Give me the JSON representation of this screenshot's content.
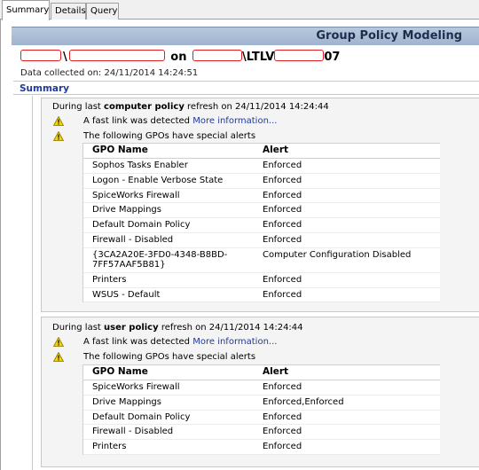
{
  "tabs": [
    {
      "label": "Summary"
    },
    {
      "label": "Details"
    },
    {
      "label": "Query"
    }
  ],
  "report_title": "Group Policy Modeling",
  "header": {
    "separator": "\\",
    "on_word": "on",
    "machine_middle": "\\LTLV",
    "machine_suffix": "07"
  },
  "data_collected": "Data collected on: 24/11/2014 14:24:51",
  "summary_label": "Summary",
  "colors": {
    "accent_link": "#1f3a99",
    "header_bar": "#9fb3cd",
    "redaction": "#e02020",
    "warning": "#f2d400"
  },
  "computer_section": {
    "prefix": "During last",
    "policy_label": "computer policy",
    "suffix": "refresh on 24/11/2014 14:24:44",
    "fast_link_text": "A fast link was detected",
    "more_info_link": "More information...",
    "gpo_alert_text": "The following GPOs have special alerts",
    "icon": "warning-icon",
    "columns": [
      "GPO Name",
      "Alert"
    ],
    "rows": [
      [
        "Sophos Tasks Enabler",
        "Enforced"
      ],
      [
        "Logon - Enable Verbose State",
        "Enforced"
      ],
      [
        "SpiceWorks Firewall",
        "Enforced"
      ],
      [
        "Drive Mappings",
        "Enforced"
      ],
      [
        "Default Domain Policy",
        "Enforced"
      ],
      [
        "Firewall - Disabled",
        "Enforced"
      ],
      [
        "{3CA2A20E-3FD0-4348-B8BD-7FF57AAF5B81}",
        "Computer Configuration Disabled"
      ],
      [
        "Printers",
        "Enforced"
      ],
      [
        "WSUS - Default",
        "Enforced"
      ]
    ]
  },
  "user_section": {
    "prefix": "During last",
    "policy_label": "user policy",
    "suffix": "refresh on 24/11/2014 14:24:44",
    "fast_link_text": "A fast link was detected",
    "more_info_link": "More information...",
    "gpo_alert_text": "The following GPOs have special alerts",
    "icon": "warning-icon",
    "columns": [
      "GPO Name",
      "Alert"
    ],
    "rows": [
      [
        "SpiceWorks Firewall",
        "Enforced"
      ],
      [
        "Drive Mappings",
        "Enforced,Enforced"
      ],
      [
        "Default Domain Policy",
        "Enforced"
      ],
      [
        "Firewall - Disabled",
        "Enforced"
      ],
      [
        "Printers",
        "Enforced"
      ]
    ]
  }
}
